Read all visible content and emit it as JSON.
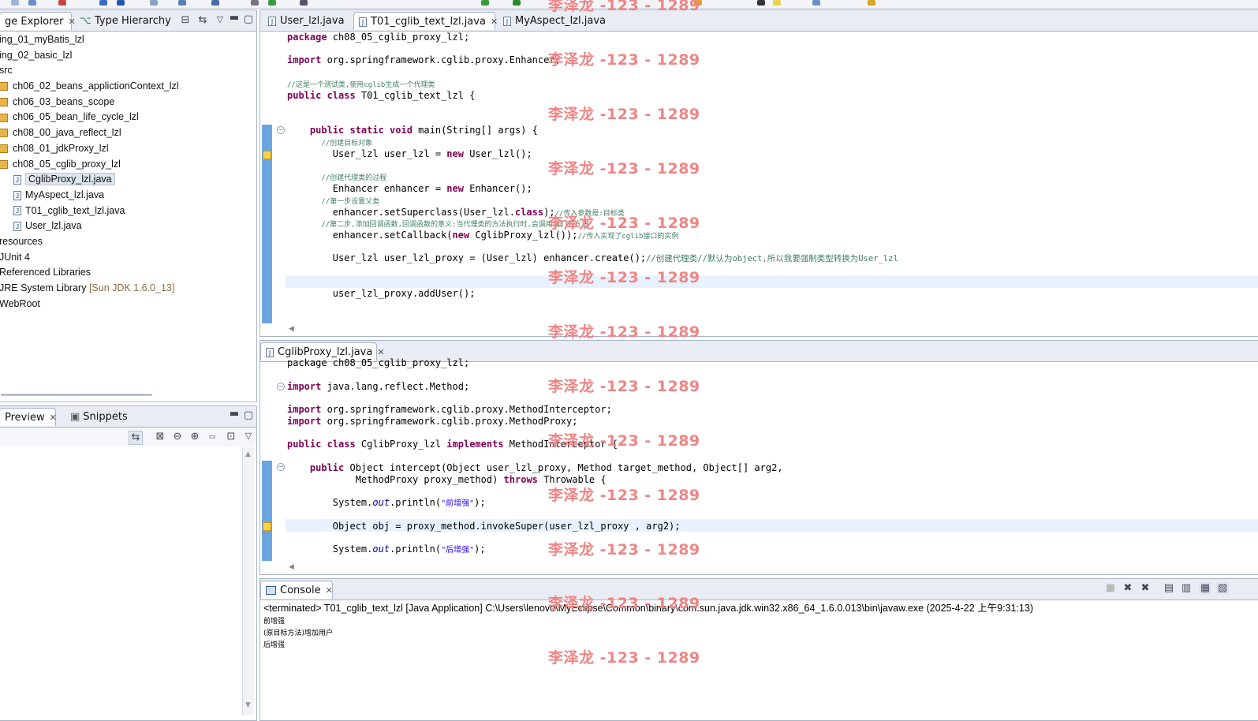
{
  "left_panel": {
    "tabs": [
      {
        "label": "ge Explorer",
        "close": "✕"
      },
      {
        "label": "Type Hierarchy"
      }
    ],
    "tree": [
      {
        "label": "ing_01_myBatis_lzl"
      },
      {
        "label": "ing_02_basic_lzl"
      },
      {
        "label": "src"
      },
      {
        "label": "ch06_02_beans_applictionContext_lzl"
      },
      {
        "label": "ch06_03_beans_scope"
      },
      {
        "label": "ch06_05_bean_life_cycle_lzl"
      },
      {
        "label": "ch08_00_java_reflect_lzl"
      },
      {
        "label": "ch08_01_jdkProxy_lzl"
      },
      {
        "label": "ch08_05_cglib_proxy_lzl"
      },
      {
        "label": "CglibProxy_lzl.java"
      },
      {
        "label": "MyAspect_lzl.java"
      },
      {
        "label": "T01_cglib_text_lzl.java"
      },
      {
        "label": "User_lzl.java"
      },
      {
        "label": "resources"
      },
      {
        "label": "JUnit 4"
      },
      {
        "label": "Referenced Libraries"
      },
      {
        "label": "JRE System Library",
        "suffix": "[Sun JDK 1.6.0_13]"
      },
      {
        "label": "WebRoot"
      }
    ]
  },
  "preview_panel": {
    "tabs": [
      {
        "label": "Preview",
        "close": "✕"
      },
      {
        "label": "Snippets"
      }
    ]
  },
  "editor_top": {
    "tabs": [
      {
        "label": "User_lzl.java"
      },
      {
        "label": "T01_cglib_text_lzl.java",
        "close": "✕"
      },
      {
        "label": "MyAspect_lzl.java"
      }
    ],
    "code": {
      "l1": "package ch08_05_cglib_proxy_lzl;",
      "l2a": "import",
      "l2b": " org.springframework.cglib.proxy.Enhancer;",
      "l3": "//这是一个测试类,使用cglib生成一个代理类",
      "l4a": "public class",
      "l4b": " T01_cglib_text_lzl {",
      "l5a": "    public static void",
      "l5b": " main(String[] args) {",
      "l6": "        //创建目标对象",
      "l7a": "        User_lzl user_lzl = ",
      "l7b": "new",
      "l7c": " User_lzl();",
      "l8": "        //创建代理类的过程",
      "l9a": "        Enhancer enhancer = ",
      "l9b": "new",
      "l9c": " Enhancer();",
      "l10": "        //第一步设置父类",
      "l11a": "        enhancer.setSuperclass(User_lzl.",
      "l11b": "class",
      "l11c": ");",
      "l11d": "//传入参数是:目标类",
      "l12": "        //第二步,添加回调函数,回调函数的意义:当代理类的方法执行时,会调用我们的方法",
      "l13a": "        enhancer.setCallback(",
      "l13b": "new",
      "l13c": " CglibProxy_lzl());",
      "l13d": "//传入实现了cglib接口的实例",
      "l14a": "        User_lzl user_lzl_proxy = (User_lzl) enhancer.create();",
      "l14b": "//创建代理类//默认为object,所以我要强制类型转换为User_lzl",
      "l15": "        user_lzl_proxy.addUser();"
    }
  },
  "editor_bottom": {
    "tabs": [
      {
        "label": "CglibProxy_lzl.java",
        "close": "✕"
      }
    ],
    "code": {
      "l1": "package ch08_05_cglib_proxy_lzl;",
      "l2a": "import",
      "l2b": " java.lang.reflect.Method;",
      "l3a": "import",
      "l3b": " org.springframework.cglib.proxy.MethodInterceptor;",
      "l4a": "import",
      "l4b": " org.springframework.cglib.proxy.MethodProxy;",
      "l5a": "public class",
      "l5b": " CglibProxy_lzl ",
      "l5c": "implements",
      "l5d": " MethodInterceptor {",
      "l6a": "    public",
      "l6b": " Object intercept(Object user_lzl_proxy, Method target_method, Object[] arg2,",
      "l7a": "            MethodProxy proxy_method) ",
      "l7b": "throws",
      "l7c": " Throwable {",
      "l8a": "        System.",
      "l8b": "out",
      "l8c": ".println(",
      "l8d": "\"前增强\"",
      "l8e": ");",
      "l9": "        Object obj = proxy_method.invokeSuper(user_lzl_proxy , arg2);",
      "l10a": "        System.",
      "l10b": "out",
      "l10c": ".println(",
      "l10d": "\"后增强\"",
      "l10e": ");"
    }
  },
  "console": {
    "tab_label": "Console",
    "close": "✕",
    "status": "<terminated> T01_cglib_text_lzl [Java Application] C:\\Users\\lenovo\\MyEclipse\\Common\\binary\\com.sun.java.jdk.win32.x86_64_1.6.0.013\\bin\\javaw.exe (2025-4-22 上午9:31:13)",
    "output": [
      "前增强",
      "(原目标方法)增加用户",
      "后增强"
    ]
  },
  "watermark": "李泽龙 -123 - 1289",
  "colors": {
    "keyword": "#7f0055",
    "comment": "#3f7f5f",
    "string": "#2a00ff",
    "watermark": "#f08484",
    "selection": "#dfe6ef"
  }
}
